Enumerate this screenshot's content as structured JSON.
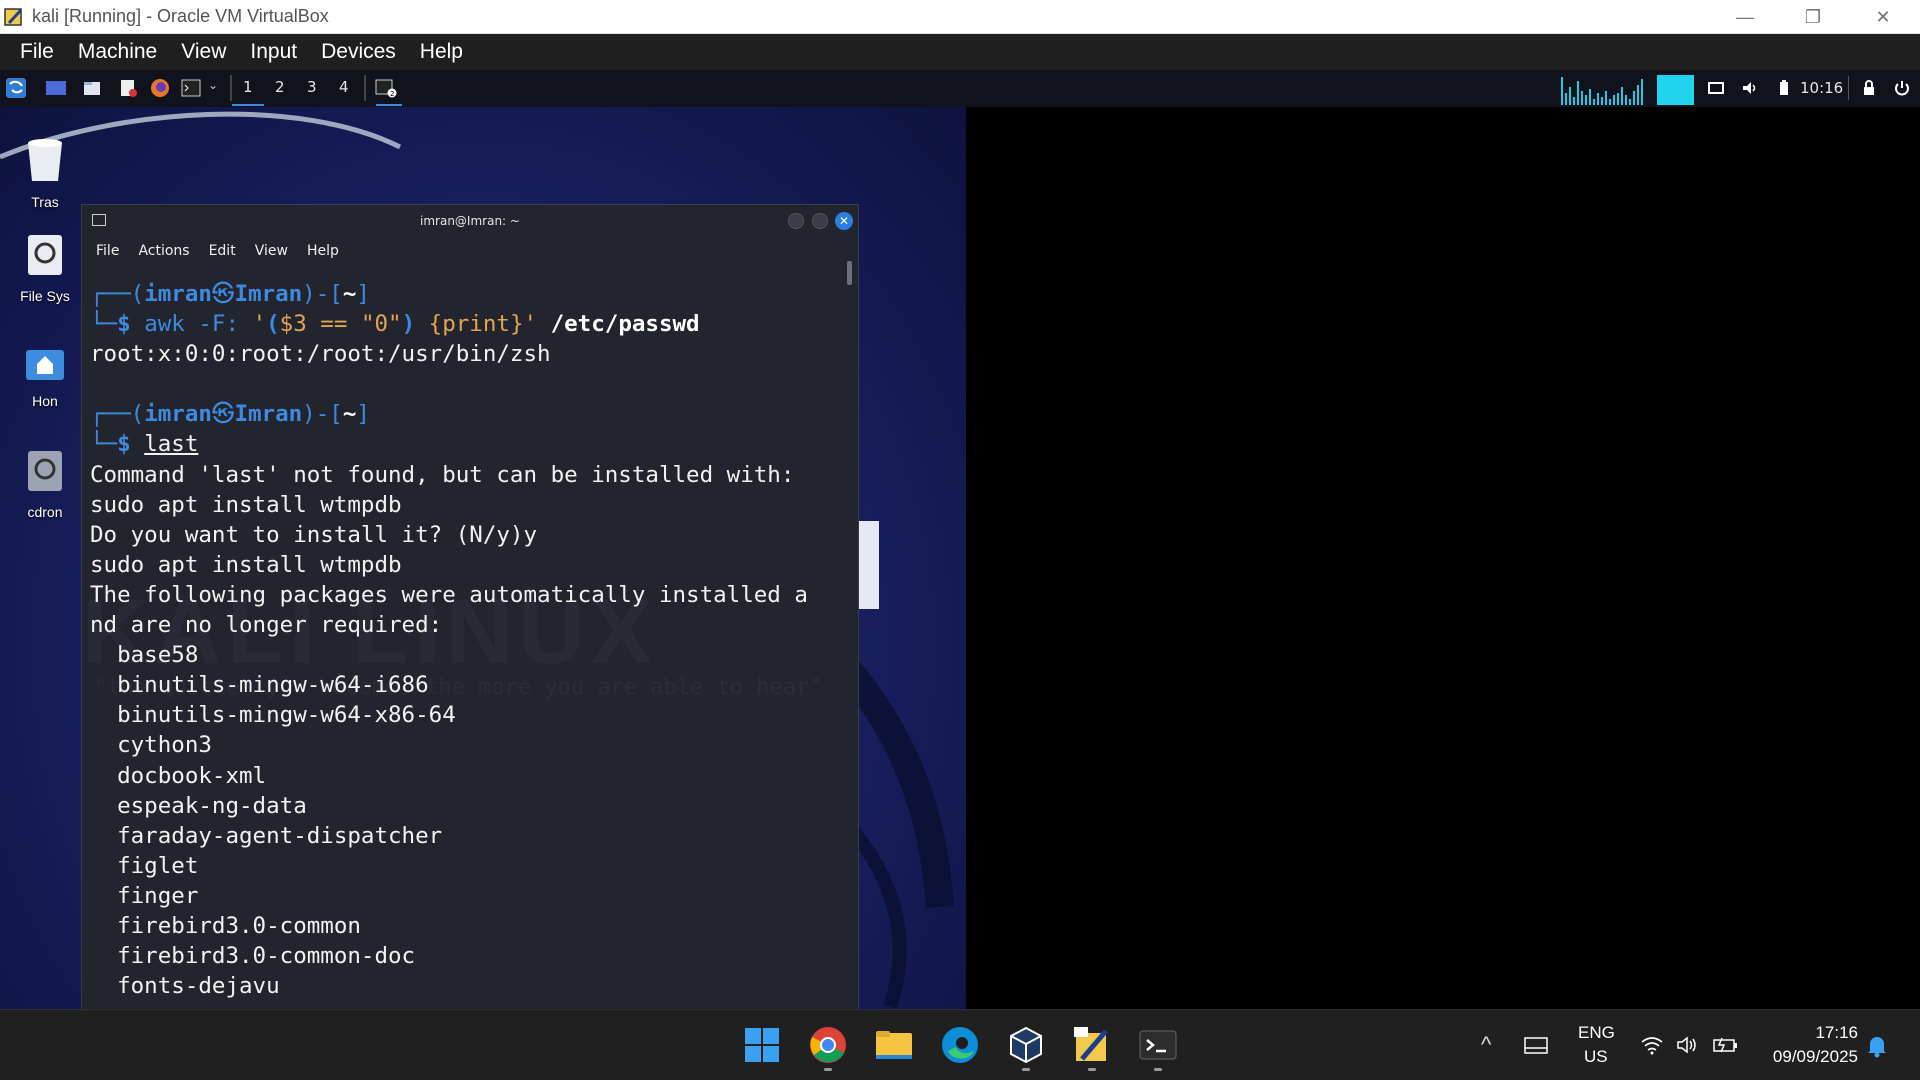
{
  "host_window": {
    "title": "kali [Running] - Oracle VM VirtualBox",
    "controls": {
      "minimize": "—",
      "restore": "❐",
      "close": "✕"
    }
  },
  "vbox_menu": [
    "File",
    "Machine",
    "View",
    "Input",
    "Devices",
    "Help"
  ],
  "kali_panel": {
    "workspaces": [
      "1",
      "2",
      "3",
      "4"
    ],
    "clock": "10:16"
  },
  "desktop_icons": [
    {
      "label": "Tras"
    },
    {
      "label": "File Sys"
    },
    {
      "label": "Hon"
    },
    {
      "label": "cdron"
    }
  ],
  "terminal": {
    "title": "imran@Imran: ~",
    "menu": [
      "File",
      "Actions",
      "Edit",
      "View",
      "Help"
    ],
    "prompt": {
      "frame_top": "┌──(",
      "user": "imran",
      "at_symbol": "㉿",
      "host": "Imran",
      "frame_mid": ")-[",
      "path": "~",
      "frame_end": "]",
      "frame_bottom": "└─",
      "dollar": "$ "
    },
    "cmd1": {
      "program": "awk",
      "flag": " -F: ",
      "q1": "'",
      "paren1": "(",
      "var": "$3",
      "op": " == ",
      "str": "\"0\"",
      "paren2": ")",
      "sp": " ",
      "block": "{print}",
      "q2": "'",
      "arg": " /etc/passwd"
    },
    "output1": "root:x:0:0:root:/root:/usr/bin/zsh",
    "cmd2": "last",
    "output2": [
      "Command 'last' not found, but can be installed with:",
      "sudo apt install wtmpdb",
      "Do you want to install it? (N/y)y",
      "sudo apt install wtmpdb",
      "The following packages were automatically installed a",
      "nd are no longer required:",
      "  base58",
      "  binutils-mingw-w64-i686",
      "  binutils-mingw-w64-x86-64",
      "  cython3",
      "  docbook-xml",
      "  espeak-ng-data",
      "  faraday-agent-dispatcher",
      "  figlet",
      "  finger",
      "  firebird3.0-common",
      "  firebird3.0-common-doc",
      "  fonts-dejavu"
    ]
  },
  "wallpaper": {
    "logo_text": "KALI LINUX",
    "quote": "\"the quieter you become, the more you are able to hear\""
  },
  "taskbar": {
    "apps": [
      "windows-start",
      "chrome",
      "file-explorer",
      "edge",
      "virtualbox",
      "virtualbox-manager",
      "terminal"
    ],
    "language_line1": "ENG",
    "language_line2": "US",
    "time": "17:16",
    "date": "09/09/2025",
    "tray_chevron": "^"
  },
  "colors": {
    "terminal_bg": "#23252e",
    "prompt_blue": "#3d8ae0",
    "awk_orange": "#e6a350",
    "taskbar_bg": "#202020"
  }
}
